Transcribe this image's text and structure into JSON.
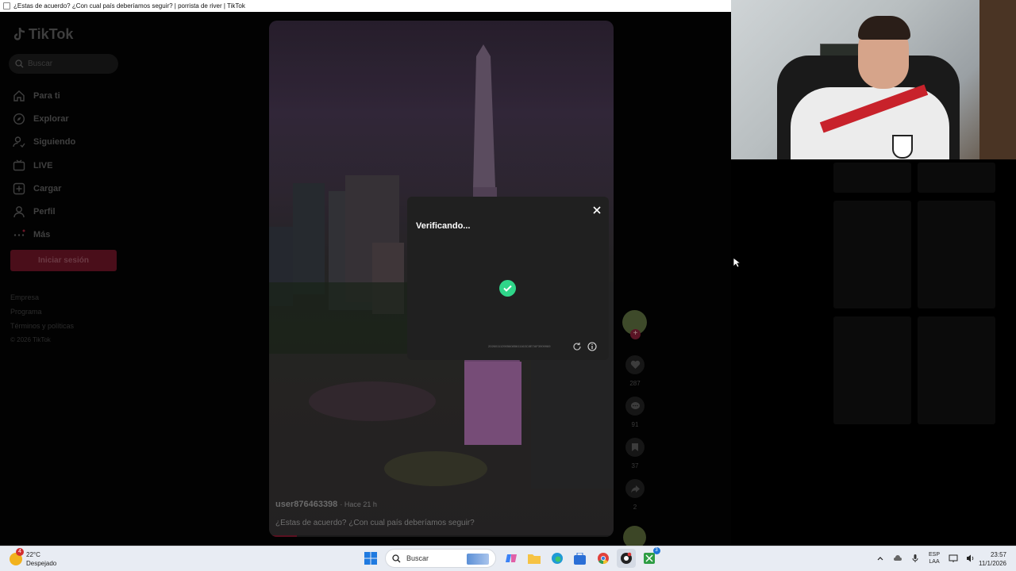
{
  "window": {
    "title": "¿Estas de acuerdo? ¿Con cual país deberíamos seguir? | porrista de river | TikTok"
  },
  "sidebar": {
    "logo": "TikTok",
    "search_placeholder": "Buscar",
    "items": [
      {
        "label": "Para ti",
        "icon": "home-icon"
      },
      {
        "label": "Explorar",
        "icon": "compass-icon"
      },
      {
        "label": "Siguiendo",
        "icon": "following-icon"
      },
      {
        "label": "LIVE",
        "icon": "live-icon"
      },
      {
        "label": "Cargar",
        "icon": "upload-icon"
      },
      {
        "label": "Perfil",
        "icon": "profile-icon"
      },
      {
        "label": "Más",
        "icon": "more-icon"
      }
    ],
    "login_label": "Iniciar sesión",
    "footer": {
      "company": "Empresa",
      "program": "Programa",
      "terms": "Términos y políticas",
      "copyright": "© 2026 TikTok"
    }
  },
  "video": {
    "username": "user876463398",
    "time_ago": "· Hace 21 h",
    "caption": "¿Estas de acuerdo? ¿Con cual país deberíamos seguir?"
  },
  "actions": {
    "likes": "287",
    "comments": "91",
    "saves": "37",
    "shares": "2"
  },
  "modal": {
    "title": "Verificando...",
    "code": "2026011129056085611163C8E7AF3909969"
  },
  "taskbar": {
    "weather_temp": "22°C",
    "weather_desc": "Despejado",
    "weather_badge": "4",
    "search_label": "Buscar",
    "lang_top": "ESP",
    "lang_bottom": "LAA",
    "time": "23:57",
    "date": "11/1/2026",
    "badge_count": "3"
  }
}
